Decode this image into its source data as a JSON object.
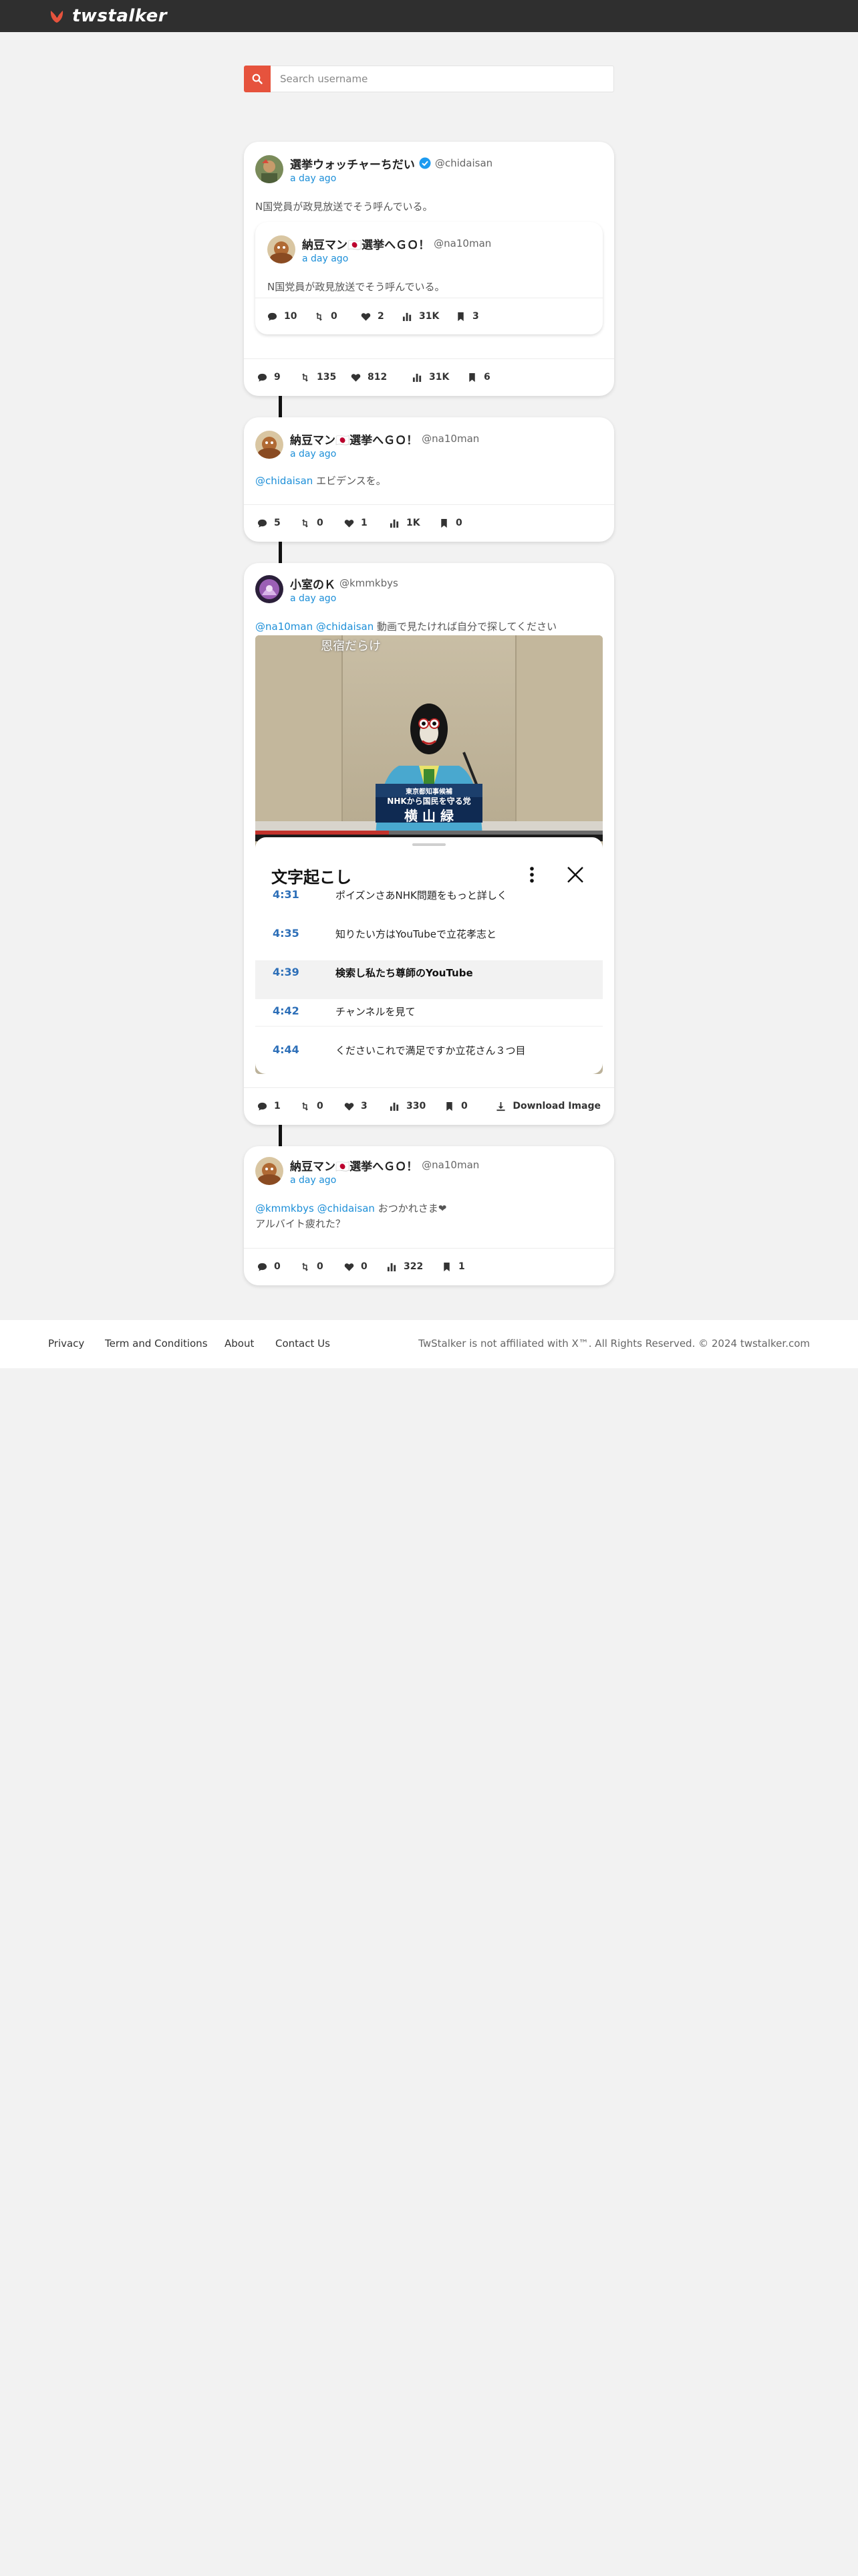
{
  "brand": {
    "name": "twstalker",
    "accent": "#e6533d",
    "topbar_color": "#2f2f2f",
    "link_color": "#1d8fd8"
  },
  "search": {
    "placeholder": "Search username"
  },
  "posts": [
    {
      "author": {
        "name": "選挙ウォッチャーちだい",
        "handle": "@chidaisan",
        "verified": true
      },
      "time": "a day ago",
      "text": "N国党員が政見放送でそう呼んでいる。",
      "quote": {
        "author": {
          "name": "納豆マン🇯🇵選挙へＧＯ！",
          "handle": "@na10man"
        },
        "time": "a day ago",
        "text": "N国党員が政見放送でそう呼んでいる。",
        "stats": {
          "replies": "10",
          "retweets": "0",
          "likes": "2",
          "views": "31K",
          "bookmarks": "3"
        }
      },
      "stats": {
        "replies": "9",
        "retweets": "135",
        "likes": "812",
        "views": "31K",
        "bookmarks": "6"
      }
    },
    {
      "author": {
        "name": "納豆マン🇯🇵選挙へＧＯ！",
        "handle": "@na10man"
      },
      "time": "a day ago",
      "mentions": [
        "@chidaisan"
      ],
      "text": "エビデンスを。",
      "stats": {
        "replies": "5",
        "retweets": "0",
        "likes": "1",
        "views": "1K",
        "bookmarks": "0"
      }
    },
    {
      "author": {
        "name": "小室のＫ",
        "handle": "@kmmkbys"
      },
      "time": "a day ago",
      "mentions": [
        "@na10man",
        "@chidaisan"
      ],
      "text": "動画で見たければ自分で探してください",
      "media": {
        "caption_top": "恩宿だらけ",
        "nameplate_small": "東京都知事候補",
        "nameplate_party": "NHKから国民を守る党",
        "nameplate_name": "横 山 緑",
        "transcript": {
          "title": "文字起こし",
          "rows": [
            {
              "time": "4:31",
              "text": "ポイズンさあNHK問題をもっと詳しく"
            },
            {
              "time": "4:35",
              "text": "知りたい方はYouTubeで立花孝志と"
            },
            {
              "time": "4:39",
              "text": "検索し私たち尊師のYouTube"
            },
            {
              "time": "4:42",
              "text": "チャンネルを見て"
            },
            {
              "time": "4:44",
              "text": "くださいこれで満足ですか立花さん３つ目"
            }
          ]
        }
      },
      "download_label": "Download Image",
      "stats": {
        "replies": "1",
        "retweets": "0",
        "likes": "3",
        "views": "330",
        "bookmarks": "0"
      }
    },
    {
      "author": {
        "name": "納豆マン🇯🇵選挙へＧＯ！",
        "handle": "@na10man"
      },
      "time": "a day ago",
      "mentions": [
        "@kmmkbys",
        "@chidaisan"
      ],
      "text": "おつかれさま❤",
      "text_line2": "アルバイト疲れた？",
      "stats": {
        "replies": "0",
        "retweets": "0",
        "likes": "0",
        "views": "322",
        "bookmarks": "1"
      }
    }
  ],
  "footer": {
    "links": [
      "Privacy",
      "Term and Conditions",
      "About",
      "Contact Us"
    ],
    "copyright": "TwStalker is not affiliated with X™. All Rights Reserved. © 2024 twstalker.com"
  }
}
